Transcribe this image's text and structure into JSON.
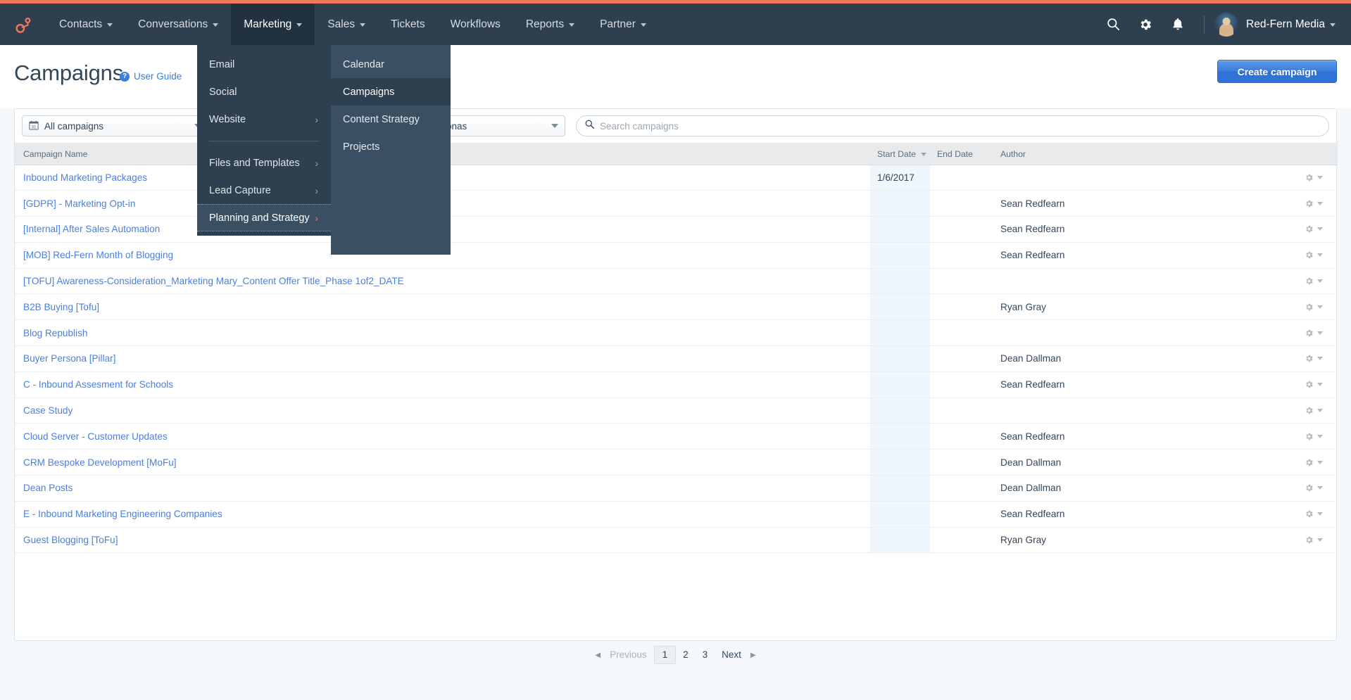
{
  "brand": {
    "logo": "hubspot-sprocket-logo",
    "accent": "#f2785c",
    "navbg": "#2e3f50"
  },
  "nav": {
    "items": [
      {
        "label": "Contacts",
        "has_caret": true,
        "active": false
      },
      {
        "label": "Conversations",
        "has_caret": true,
        "active": false
      },
      {
        "label": "Marketing",
        "has_caret": true,
        "active": true
      },
      {
        "label": "Sales",
        "has_caret": true,
        "active": false
      },
      {
        "label": "Tickets",
        "has_caret": false,
        "active": false
      },
      {
        "label": "Workflows",
        "has_caret": false,
        "active": false
      },
      {
        "label": "Reports",
        "has_caret": true,
        "active": false
      },
      {
        "label": "Partner",
        "has_caret": true,
        "active": false
      }
    ],
    "icons": [
      "search-icon",
      "gear-icon",
      "bell-icon"
    ],
    "account_name": "Red-Fern Media"
  },
  "menu": {
    "primary": [
      {
        "label": "Email",
        "submenu": false,
        "selected": false
      },
      {
        "label": "Social",
        "submenu": false,
        "selected": false
      },
      {
        "label": "Website",
        "submenu": true,
        "selected": false
      },
      {
        "separator": true
      },
      {
        "label": "Files and Templates",
        "submenu": true,
        "selected": false
      },
      {
        "label": "Lead Capture",
        "submenu": true,
        "selected": false
      },
      {
        "label": "Planning and Strategy",
        "submenu": true,
        "selected": true
      }
    ],
    "submenu": [
      {
        "label": "Calendar",
        "active": false
      },
      {
        "label": "Campaigns",
        "active": true
      },
      {
        "label": "Content Strategy",
        "active": false
      },
      {
        "label": "Projects",
        "active": false
      }
    ]
  },
  "header": {
    "title": "Campaigns",
    "user_guide": "User Guide",
    "help_badge": "?",
    "create_button": "Create campaign"
  },
  "filters": {
    "campaign_select": "All campaigns",
    "hidden_select": "",
    "persona_select": "All personas",
    "search_placeholder": "Search campaigns",
    "search_value": ""
  },
  "table": {
    "columns": [
      {
        "key": "name",
        "label": "Campaign Name",
        "sorted": false
      },
      {
        "key": "start",
        "label": "Start Date",
        "sorted": true
      },
      {
        "key": "end",
        "label": "End Date",
        "sorted": false
      },
      {
        "key": "author",
        "label": "Author",
        "sorted": false
      },
      {
        "key": "actions",
        "label": "",
        "sorted": false
      }
    ],
    "rows": [
      {
        "name": "Inbound Marketing Packages",
        "start": "1/6/2017",
        "end": "",
        "author": ""
      },
      {
        "name": "[GDPR] - Marketing Opt-in",
        "start": "",
        "end": "",
        "author": "Sean Redfearn"
      },
      {
        "name": "[Internal] After Sales Automation",
        "start": "",
        "end": "",
        "author": "Sean Redfearn"
      },
      {
        "name": "[MOB] Red-Fern Month of Blogging",
        "start": "",
        "end": "",
        "author": "Sean Redfearn"
      },
      {
        "name": "[TOFU] Awareness-Consideration_Marketing Mary_Content Offer Title_Phase 1of2_DATE",
        "start": "",
        "end": "",
        "author": ""
      },
      {
        "name": "B2B Buying [Tofu]",
        "start": "",
        "end": "",
        "author": "Ryan Gray"
      },
      {
        "name": "Blog Republish",
        "start": "",
        "end": "",
        "author": ""
      },
      {
        "name": "Buyer Persona [Pillar]",
        "start": "",
        "end": "",
        "author": "Dean Dallman"
      },
      {
        "name": "C - Inbound Assesment for Schools",
        "start": "",
        "end": "",
        "author": "Sean Redfearn"
      },
      {
        "name": "Case Study",
        "start": "",
        "end": "",
        "author": ""
      },
      {
        "name": "Cloud Server - Customer Updates",
        "start": "",
        "end": "",
        "author": "Sean Redfearn"
      },
      {
        "name": "CRM Bespoke Development [MoFu]",
        "start": "",
        "end": "",
        "author": "Dean Dallman"
      },
      {
        "name": "Dean Posts",
        "start": "",
        "end": "",
        "author": "Dean Dallman"
      },
      {
        "name": "E - Inbound Marketing Engineering Companies",
        "start": "",
        "end": "",
        "author": "Sean Redfearn"
      },
      {
        "name": "Guest Blogging [ToFu]",
        "start": "",
        "end": "",
        "author": "Ryan Gray"
      }
    ]
  },
  "pagination": {
    "previous": "Previous",
    "pages": [
      "1",
      "2",
      "3"
    ],
    "current": "1",
    "next": "Next"
  }
}
